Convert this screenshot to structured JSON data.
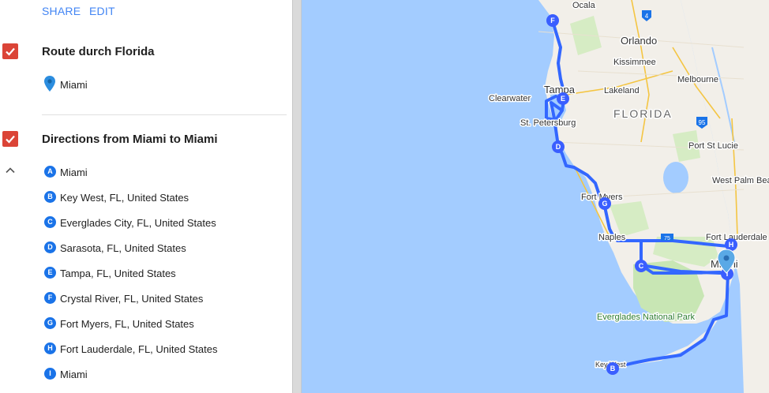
{
  "toolbar": {
    "share_label": "SHARE",
    "edit_label": "EDIT"
  },
  "layers": [
    {
      "title": "Route durch Florida",
      "checked": true,
      "places": [
        {
          "label": "Miami",
          "icon": "location-pin-icon"
        }
      ]
    },
    {
      "title": "Directions from Miami to Miami",
      "checked": true
    }
  ],
  "directions": {
    "stops": [
      {
        "letter": "A",
        "label": "Miami"
      },
      {
        "letter": "B",
        "label": "Key West, FL, United States"
      },
      {
        "letter": "C",
        "label": "Everglades City, FL, United States"
      },
      {
        "letter": "D",
        "label": "Sarasota, FL, United States"
      },
      {
        "letter": "E",
        "label": "Tampa, FL, United States"
      },
      {
        "letter": "F",
        "label": "Crystal River, FL, United States"
      },
      {
        "letter": "G",
        "label": "Fort Myers, FL, United States"
      },
      {
        "letter": "H",
        "label": "Fort Lauderdale, FL, United States"
      },
      {
        "letter": "I",
        "label": "Miami"
      }
    ]
  },
  "map": {
    "region_label": "FLORIDA",
    "cities": [
      "Ocala",
      "Orlando",
      "Kissimmee",
      "Melbourne",
      "Lakeland",
      "Tampa",
      "Clearwater",
      "St. Petersburg",
      "Port St Lucie",
      "West Palm Beach",
      "Fort Myers",
      "Naples",
      "Fort Lauderdale",
      "Miami",
      "Key West"
    ],
    "park_label": "Everglades National Park",
    "highways": [
      "4",
      "95",
      "75"
    ],
    "colors": {
      "water": "#a3ccff",
      "land": "#f2efe9",
      "route": "#3367ff",
      "park": "#c8e6b4",
      "checkbox": "#db4437"
    }
  }
}
